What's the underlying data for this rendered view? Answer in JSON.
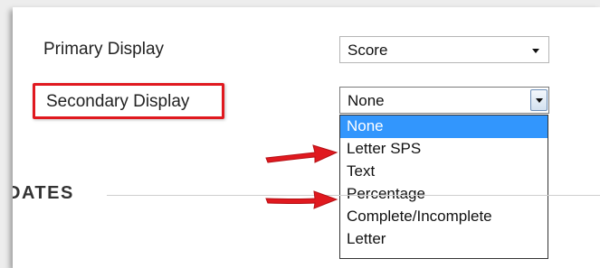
{
  "settings": {
    "primary_display_label": "Primary Display",
    "primary_display_value": "Score",
    "secondary_display_label": "Secondary Display",
    "secondary_display_value": "None"
  },
  "dropdown": {
    "options": [
      "None",
      "Letter SPS",
      "Text",
      "Percentage",
      "Complete/Incomplete",
      "Letter"
    ],
    "highlighted": "None"
  },
  "section": {
    "title_partial": "DATES"
  },
  "colors": {
    "highlight_box": "#e0191f",
    "arrow": "#e0191f",
    "selected_option": "#3296fd"
  },
  "icons": [
    "chevron-down-icon",
    "red-arrow-icon"
  ]
}
